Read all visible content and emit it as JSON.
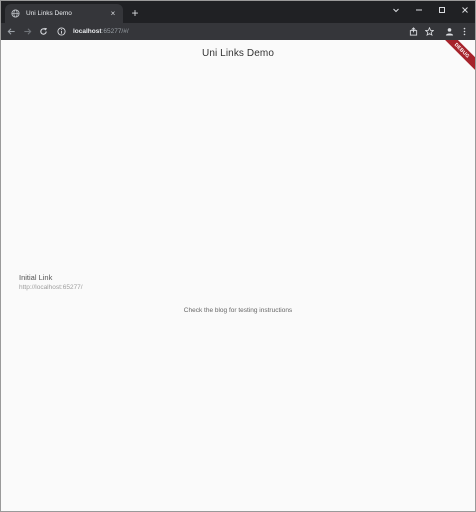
{
  "browser": {
    "tab": {
      "title": "Uni Links Demo",
      "close": "×"
    },
    "new_tab": "+",
    "url": {
      "host": "localhost",
      "rest": ":65277/#/"
    }
  },
  "page": {
    "title": "Uni Links Demo",
    "debug_banner": "DEBUG",
    "initial_link_label": "Initial Link",
    "initial_link_value": "http://localhost:65277/",
    "note": "Check the blog for testing instructions"
  },
  "colors": {
    "chrome_dark": "#202124",
    "chrome_toolbar": "#35363a",
    "debug_banner": "#a6232b",
    "page_bg": "#fafafa"
  }
}
